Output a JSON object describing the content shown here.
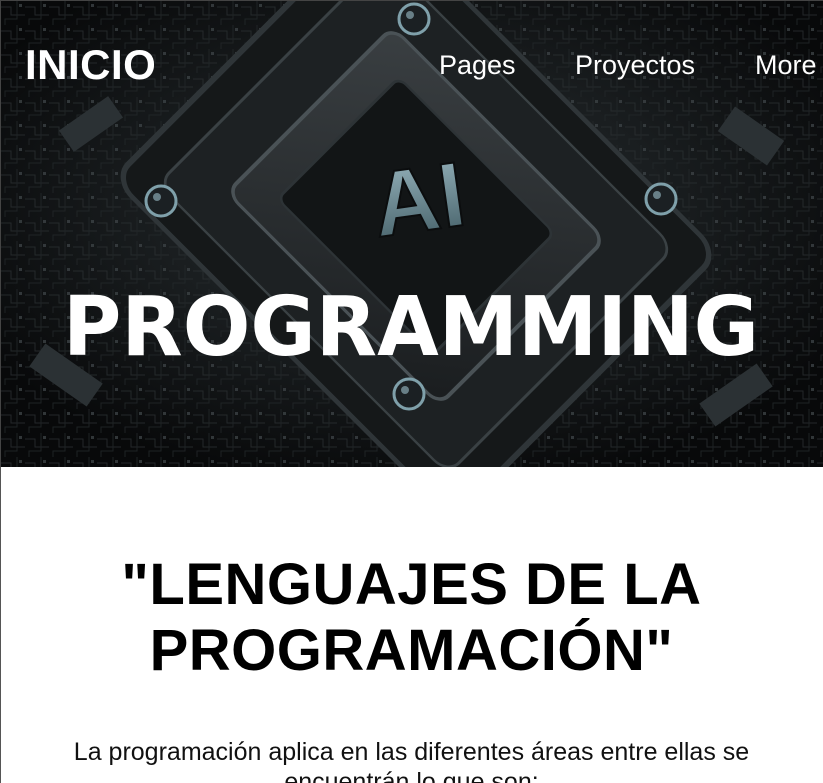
{
  "nav": {
    "brand": "INICIO",
    "links": [
      "Pages",
      "Proyectos",
      "More"
    ]
  },
  "hero": {
    "chip_label": "AI",
    "title": "PROGRAMMING"
  },
  "main": {
    "title_line1": "\"LENGUAJES DE LA",
    "title_line2": "PROGRAMACIÓN\"",
    "intro": "La programación aplica en las diferentes áreas entre ellas se encuentrán lo que son:"
  },
  "colors": {
    "hero_background": "#0b0d0e",
    "nav_text": "#ffffff",
    "chip_accent": "#6f8f98",
    "body_text": "#000000"
  }
}
